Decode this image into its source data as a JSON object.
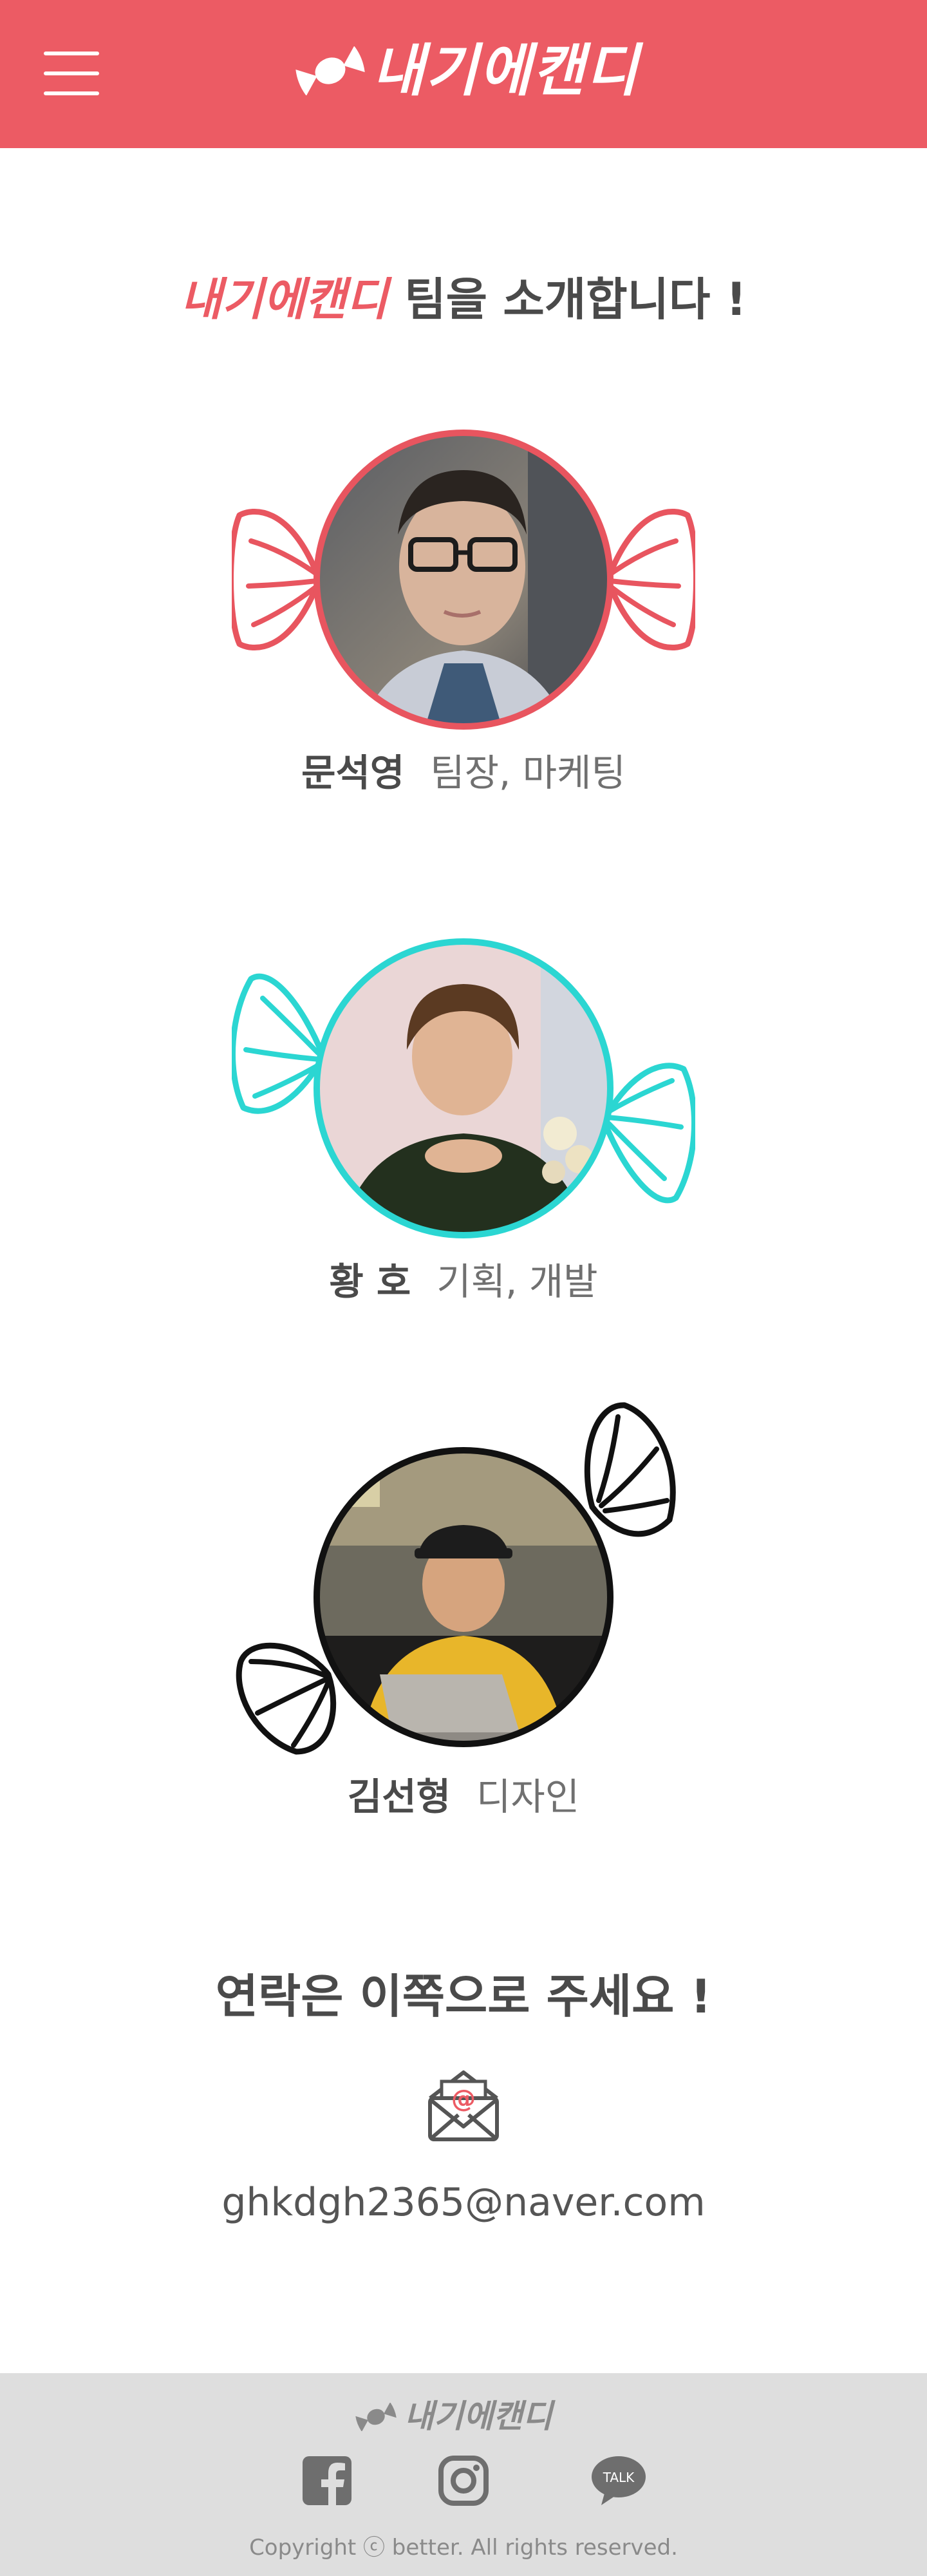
{
  "header": {
    "brand": "내기에캔디",
    "menu_icon": "hamburger-menu-icon",
    "logo_icon": "candy-icon",
    "background": "#ec5b64"
  },
  "intro": {
    "brand": "내기에캔디",
    "title": "팀을 소개합니다 !"
  },
  "team": [
    {
      "name": "문석영",
      "role": "팀장, 마케팅",
      "frame_color": "#e8555f"
    },
    {
      "name": "황 호",
      "role": "기획, 개발",
      "frame_color": "#2bd6d2"
    },
    {
      "name": "김선형",
      "role": "디자인",
      "frame_color": "#111111"
    }
  ],
  "contact": {
    "title": "연락은 이쪽으로 주세요 !",
    "icon": "email-envelope-icon",
    "email": "ghkdgh2365@naver.com"
  },
  "footer": {
    "brand": "내기에캔디",
    "social": [
      {
        "icon": "facebook-icon"
      },
      {
        "icon": "instagram-icon"
      },
      {
        "icon": "kakaotalk-icon",
        "label": "TALK"
      }
    ],
    "copyright": "Copyright ⓒ better. All rights reserved."
  }
}
